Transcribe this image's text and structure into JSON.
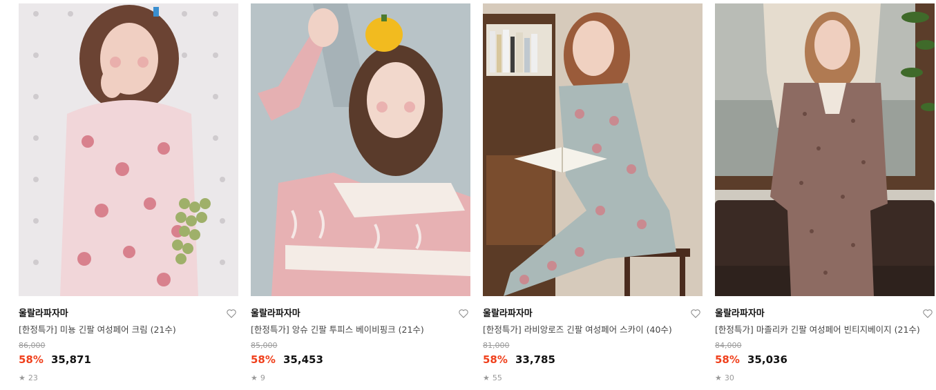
{
  "products": [
    {
      "brand": "울랄라파자마",
      "title": "[한정특가] 미뇽 긴팔 여성페어 크림 (21수)",
      "original_price": "86,000",
      "discount": "58%",
      "price": "35,871",
      "reviews": "23",
      "photo": "woman-in-cream-floral-pajamas-with-grapes",
      "colors": {
        "bg": "#e9e7e8",
        "main": "#f1d6d9",
        "accent": "#d8818d",
        "hair": "#6b4333"
      }
    },
    {
      "brand": "울랄라파자마",
      "title": "[한정특가] 앙슈 긴팔 투피스 베이비핑크 (21수)",
      "original_price": "85,000",
      "discount": "58%",
      "price": "35,453",
      "reviews": "9",
      "photo": "woman-in-pink-ruffled-pajamas-with-pepper",
      "colors": {
        "bg": "#b7c2c6",
        "main": "#e7b1b3",
        "accent": "#f3e9e4",
        "hair": "#5a3b2b"
      }
    },
    {
      "brand": "울랄라파자마",
      "title": "[한정특가] 라비앙로즈 긴팔 여성페어 스카이 (40수)",
      "original_price": "81,000",
      "discount": "58%",
      "price": "33,785",
      "reviews": "55",
      "photo": "woman-reading-in-sky-floral-pajamas",
      "colors": {
        "bg": "#d4c8b8",
        "main": "#aab9b8",
        "accent": "#c98a90",
        "hair": "#9a5b3a"
      }
    },
    {
      "brand": "울랄라파자마",
      "title": "[한정특가] 마졸리카 긴팔 여성페어 빈티지베이지 (21수)",
      "original_price": "84,000",
      "discount": "58%",
      "price": "35,036",
      "reviews": "30",
      "photo": "woman-in-vintage-beige-pajamas-by-window",
      "colors": {
        "bg": "#c9c6bd",
        "main": "#8d6b62",
        "accent": "#efe6dc",
        "hair": "#b07a52"
      }
    }
  ]
}
